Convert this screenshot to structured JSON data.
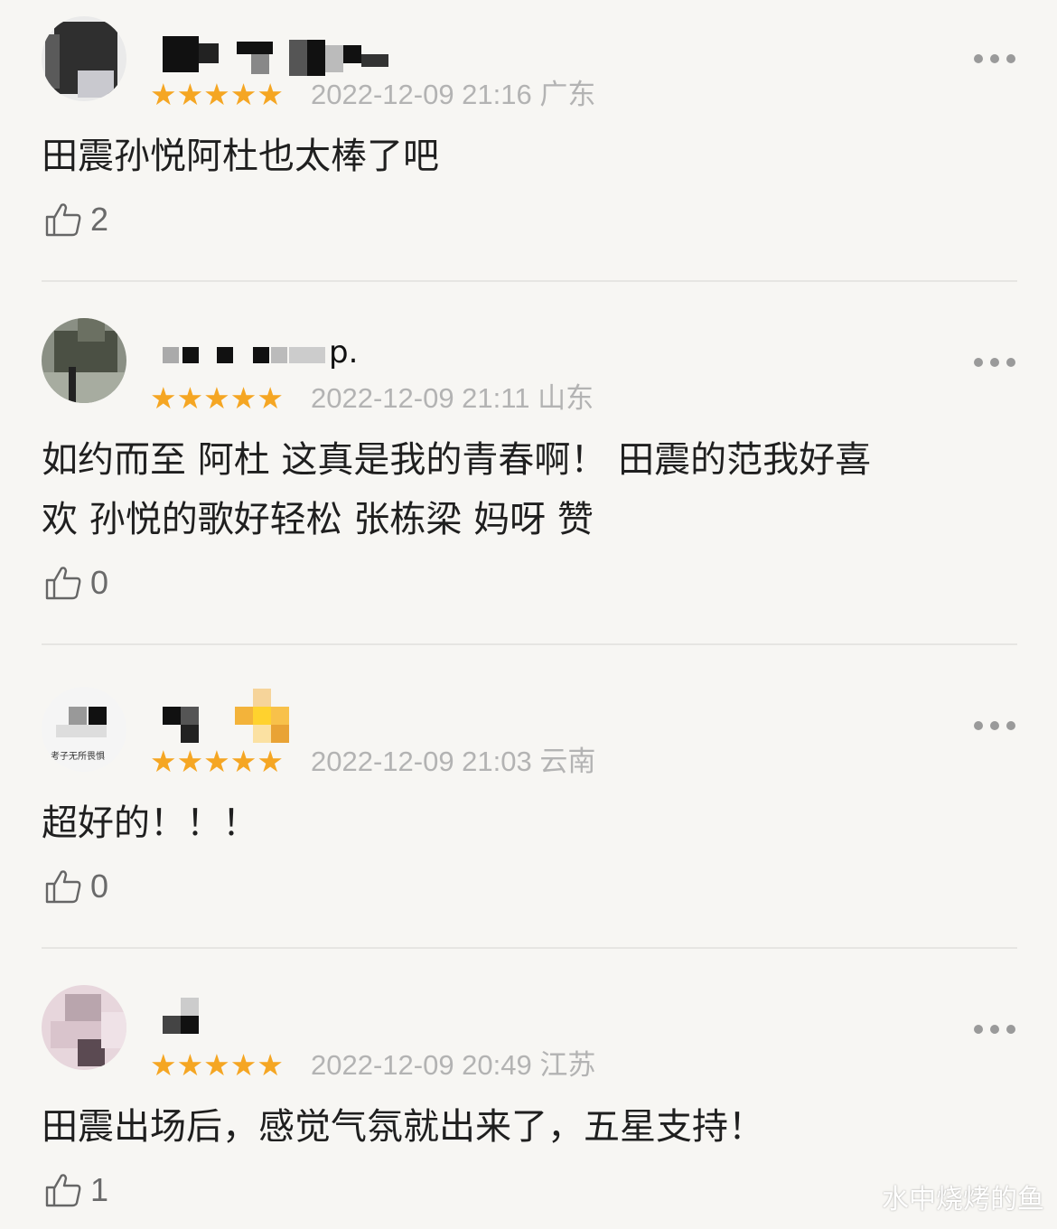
{
  "reviews": [
    {
      "rating_stars": "★★★★★",
      "rating": 5,
      "date": "2022-12-09 21:16",
      "region": "广东",
      "content": "田震孙悦阿杜也太棒了吧",
      "likes": "2",
      "username_visible_suffix": ""
    },
    {
      "rating_stars": "★★★★★",
      "rating": 5,
      "date": "2022-12-09 21:11",
      "region": "山东",
      "content_line1": "如约而至 阿杜 这真是我的青春啊！ 田震的范我好喜",
      "content_line2": "欢 孙悦的歌好轻松 张栋梁 妈呀 赞",
      "likes": "0",
      "username_visible_suffix": "p."
    },
    {
      "rating_stars": "★★★★★",
      "rating": 5,
      "date": "2022-12-09 21:03",
      "region": "云南",
      "content": "超好的！！！",
      "likes": "0",
      "avatar_caption": "考子无所畏惧"
    },
    {
      "rating_stars": "★★★★★",
      "rating": 5,
      "date": "2022-12-09 20:49",
      "region": "江苏",
      "content": "田震出场后，感觉气氛就出来了，五星支持！",
      "likes": "1"
    }
  ],
  "watermark": "水中烧烤的鱼",
  "colors": {
    "background": "#f7f6f3",
    "star": "#f5a623",
    "meta_text": "#b3b3b3",
    "divider": "#e6e5e2"
  },
  "icons": {
    "like": "thumbs-up-outline-icon",
    "more": "more-dots-icon"
  }
}
